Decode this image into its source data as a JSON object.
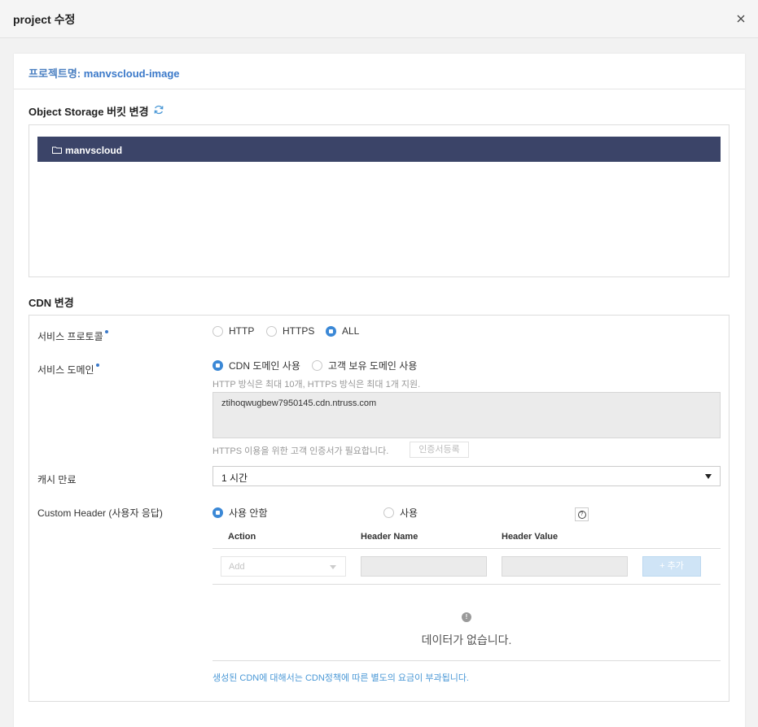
{
  "modal": {
    "title": "project 수정"
  },
  "project": {
    "label": "프로젝트명:",
    "name": "manvscloud-image"
  },
  "storage": {
    "title": "Object Storage 버킷 변경",
    "bucket_name": "manvscloud"
  },
  "cdn": {
    "title": "CDN 변경",
    "protocol": {
      "label": "서비스 프로토콜",
      "options": [
        "HTTP",
        "HTTPS",
        "ALL"
      ],
      "selected": "ALL"
    },
    "domain": {
      "label": "서비스 도메인",
      "options": [
        "CDN 도메인 사용",
        "고객 보유 도메인 사용"
      ],
      "selected": "CDN 도메인 사용",
      "hint": "HTTP 방식은 최대 10개, HTTPS 방식은 최대 1개 지원.",
      "value": "ztihoqwugbew7950145.cdn.ntruss.com",
      "cert_hint": "HTTPS 이용을 위한 고객 인증서가 필요합니다.",
      "cert_button": "인증서등록"
    },
    "cache": {
      "label": "캐시 만료",
      "value": "1 시간"
    },
    "custom_header": {
      "label": "Custom Header (사용자 응답)",
      "options": [
        "사용 안함",
        "사용"
      ],
      "selected": "사용 안함",
      "columns": [
        "Action",
        "Header Name",
        "Header Value"
      ],
      "action_placeholder": "Add",
      "add_button": "+ 추가",
      "empty": "데이터가 없습니다."
    },
    "footnote": "생성된 CDN에 대해서는 CDN정책에 따른 별도의 요금이 부과됩니다."
  },
  "colors": {
    "accent": "#3b88d6",
    "bucket_bg": "#3b4468",
    "link": "#4a98d6"
  }
}
